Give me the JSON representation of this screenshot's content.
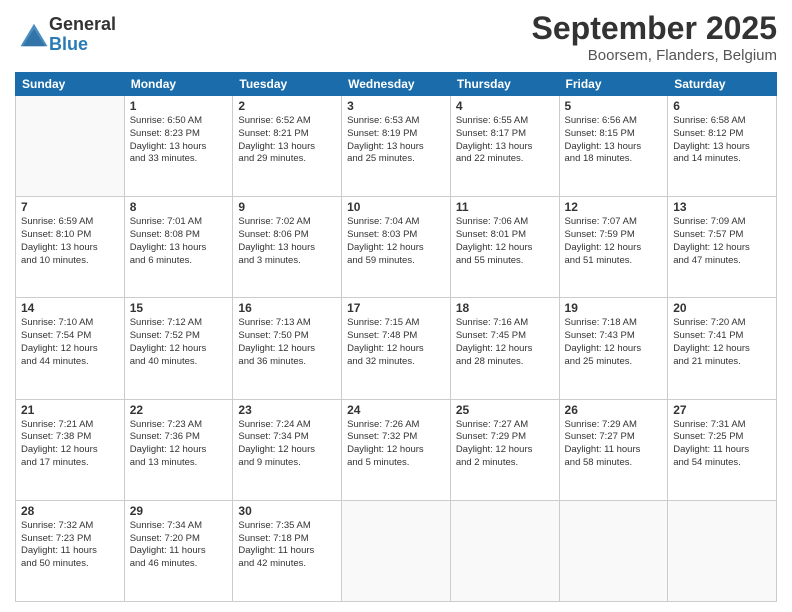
{
  "logo": {
    "general": "General",
    "blue": "Blue"
  },
  "header": {
    "month": "September 2025",
    "location": "Boorsem, Flanders, Belgium"
  },
  "days": [
    "Sunday",
    "Monday",
    "Tuesday",
    "Wednesday",
    "Thursday",
    "Friday",
    "Saturday"
  ],
  "weeks": [
    [
      {
        "day": "",
        "content": ""
      },
      {
        "day": "1",
        "content": "Sunrise: 6:50 AM\nSunset: 8:23 PM\nDaylight: 13 hours\nand 33 minutes."
      },
      {
        "day": "2",
        "content": "Sunrise: 6:52 AM\nSunset: 8:21 PM\nDaylight: 13 hours\nand 29 minutes."
      },
      {
        "day": "3",
        "content": "Sunrise: 6:53 AM\nSunset: 8:19 PM\nDaylight: 13 hours\nand 25 minutes."
      },
      {
        "day": "4",
        "content": "Sunrise: 6:55 AM\nSunset: 8:17 PM\nDaylight: 13 hours\nand 22 minutes."
      },
      {
        "day": "5",
        "content": "Sunrise: 6:56 AM\nSunset: 8:15 PM\nDaylight: 13 hours\nand 18 minutes."
      },
      {
        "day": "6",
        "content": "Sunrise: 6:58 AM\nSunset: 8:12 PM\nDaylight: 13 hours\nand 14 minutes."
      }
    ],
    [
      {
        "day": "7",
        "content": "Sunrise: 6:59 AM\nSunset: 8:10 PM\nDaylight: 13 hours\nand 10 minutes."
      },
      {
        "day": "8",
        "content": "Sunrise: 7:01 AM\nSunset: 8:08 PM\nDaylight: 13 hours\nand 6 minutes."
      },
      {
        "day": "9",
        "content": "Sunrise: 7:02 AM\nSunset: 8:06 PM\nDaylight: 13 hours\nand 3 minutes."
      },
      {
        "day": "10",
        "content": "Sunrise: 7:04 AM\nSunset: 8:03 PM\nDaylight: 12 hours\nand 59 minutes."
      },
      {
        "day": "11",
        "content": "Sunrise: 7:06 AM\nSunset: 8:01 PM\nDaylight: 12 hours\nand 55 minutes."
      },
      {
        "day": "12",
        "content": "Sunrise: 7:07 AM\nSunset: 7:59 PM\nDaylight: 12 hours\nand 51 minutes."
      },
      {
        "day": "13",
        "content": "Sunrise: 7:09 AM\nSunset: 7:57 PM\nDaylight: 12 hours\nand 47 minutes."
      }
    ],
    [
      {
        "day": "14",
        "content": "Sunrise: 7:10 AM\nSunset: 7:54 PM\nDaylight: 12 hours\nand 44 minutes."
      },
      {
        "day": "15",
        "content": "Sunrise: 7:12 AM\nSunset: 7:52 PM\nDaylight: 12 hours\nand 40 minutes."
      },
      {
        "day": "16",
        "content": "Sunrise: 7:13 AM\nSunset: 7:50 PM\nDaylight: 12 hours\nand 36 minutes."
      },
      {
        "day": "17",
        "content": "Sunrise: 7:15 AM\nSunset: 7:48 PM\nDaylight: 12 hours\nand 32 minutes."
      },
      {
        "day": "18",
        "content": "Sunrise: 7:16 AM\nSunset: 7:45 PM\nDaylight: 12 hours\nand 28 minutes."
      },
      {
        "day": "19",
        "content": "Sunrise: 7:18 AM\nSunset: 7:43 PM\nDaylight: 12 hours\nand 25 minutes."
      },
      {
        "day": "20",
        "content": "Sunrise: 7:20 AM\nSunset: 7:41 PM\nDaylight: 12 hours\nand 21 minutes."
      }
    ],
    [
      {
        "day": "21",
        "content": "Sunrise: 7:21 AM\nSunset: 7:38 PM\nDaylight: 12 hours\nand 17 minutes."
      },
      {
        "day": "22",
        "content": "Sunrise: 7:23 AM\nSunset: 7:36 PM\nDaylight: 12 hours\nand 13 minutes."
      },
      {
        "day": "23",
        "content": "Sunrise: 7:24 AM\nSunset: 7:34 PM\nDaylight: 12 hours\nand 9 minutes."
      },
      {
        "day": "24",
        "content": "Sunrise: 7:26 AM\nSunset: 7:32 PM\nDaylight: 12 hours\nand 5 minutes."
      },
      {
        "day": "25",
        "content": "Sunrise: 7:27 AM\nSunset: 7:29 PM\nDaylight: 12 hours\nand 2 minutes."
      },
      {
        "day": "26",
        "content": "Sunrise: 7:29 AM\nSunset: 7:27 PM\nDaylight: 11 hours\nand 58 minutes."
      },
      {
        "day": "27",
        "content": "Sunrise: 7:31 AM\nSunset: 7:25 PM\nDaylight: 11 hours\nand 54 minutes."
      }
    ],
    [
      {
        "day": "28",
        "content": "Sunrise: 7:32 AM\nSunset: 7:23 PM\nDaylight: 11 hours\nand 50 minutes."
      },
      {
        "day": "29",
        "content": "Sunrise: 7:34 AM\nSunset: 7:20 PM\nDaylight: 11 hours\nand 46 minutes."
      },
      {
        "day": "30",
        "content": "Sunrise: 7:35 AM\nSunset: 7:18 PM\nDaylight: 11 hours\nand 42 minutes."
      },
      {
        "day": "",
        "content": ""
      },
      {
        "day": "",
        "content": ""
      },
      {
        "day": "",
        "content": ""
      },
      {
        "day": "",
        "content": ""
      }
    ]
  ]
}
